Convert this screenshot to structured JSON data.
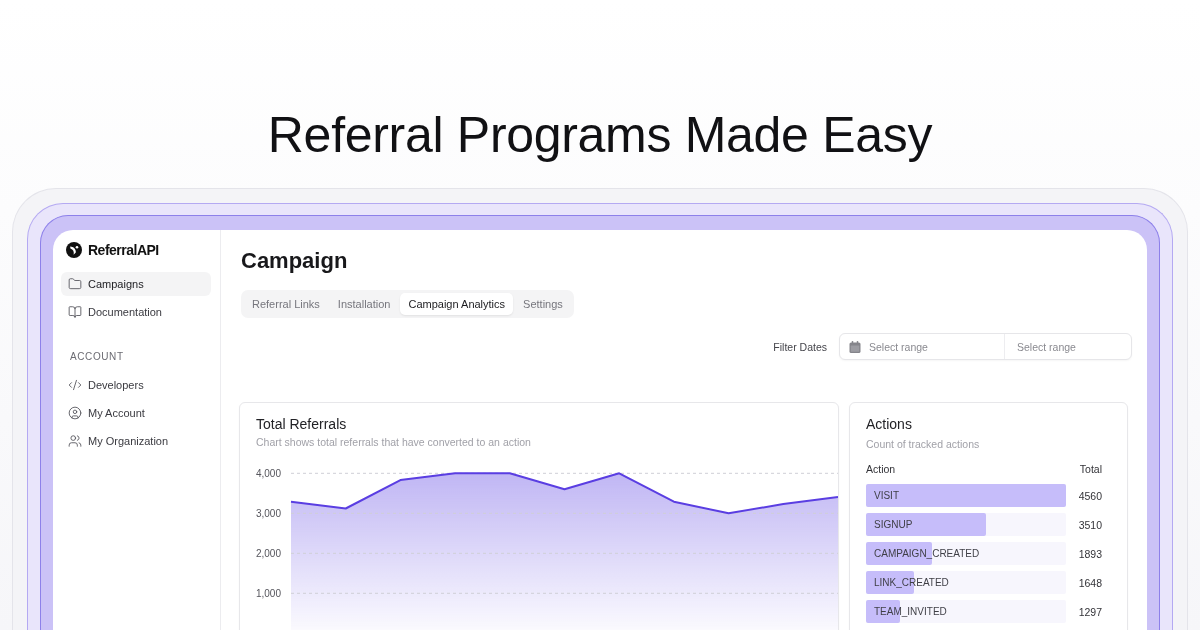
{
  "headline": "Referral Programs Made Easy",
  "sidebar": {
    "brand": "ReferralAPI",
    "items": [
      {
        "label": "Campaigns",
        "selected": true
      },
      {
        "label": "Documentation",
        "selected": false
      }
    ],
    "section_title": "ACCOUNT",
    "account_items": [
      {
        "label": "Developers",
        "selected": false
      },
      {
        "label": "My Account",
        "selected": false
      },
      {
        "label": "My Organization",
        "selected": false
      }
    ]
  },
  "page": {
    "title": "Campaign",
    "tabs": [
      {
        "label": "Referral Links",
        "selected": false
      },
      {
        "label": "Installation",
        "selected": false
      },
      {
        "label": "Campaign Analytics",
        "selected": true
      },
      {
        "label": "Settings",
        "selected": false
      }
    ],
    "filter": {
      "label": "Filter Dates",
      "start": {
        "placeholder": "Select range"
      },
      "end": {
        "placeholder": "Select range"
      }
    }
  },
  "referrals_card": {
    "title": "Total Referrals",
    "subtitle": "Chart shows total referrals that have converted to an action",
    "chart_data": {
      "type": "area",
      "grid": true,
      "ylim": [
        0,
        4000
      ],
      "yticks": [
        {
          "value": 1000,
          "label": "1,000"
        },
        {
          "value": 2000,
          "label": "2,000"
        },
        {
          "value": 3000,
          "label": "3,000"
        },
        {
          "value": 4000,
          "label": "4,000"
        }
      ],
      "series": [
        {
          "color": "#5a3ee2",
          "values": [
            3290,
            3120,
            3830,
            4000,
            4000,
            3600,
            4000,
            3290,
            3000,
            3230,
            3410
          ]
        }
      ]
    }
  },
  "actions_card": {
    "title": "Actions",
    "subtitle": "Count of tracked actions",
    "columns": [
      "Action",
      "Total"
    ],
    "rows": [
      {
        "action": "VISIT",
        "total": "4560",
        "level": 1.0
      },
      {
        "action": "SIGNUP",
        "total": "3510",
        "level": 0.6
      },
      {
        "action": "CAMPAIGN_CREATED",
        "total": "1893",
        "level": 0.33
      },
      {
        "action": "LINK_CREATED",
        "total": "1648",
        "level": 0.24
      },
      {
        "action": "TEAM_INVITED",
        "total": "1297",
        "level": 0.17
      }
    ]
  }
}
